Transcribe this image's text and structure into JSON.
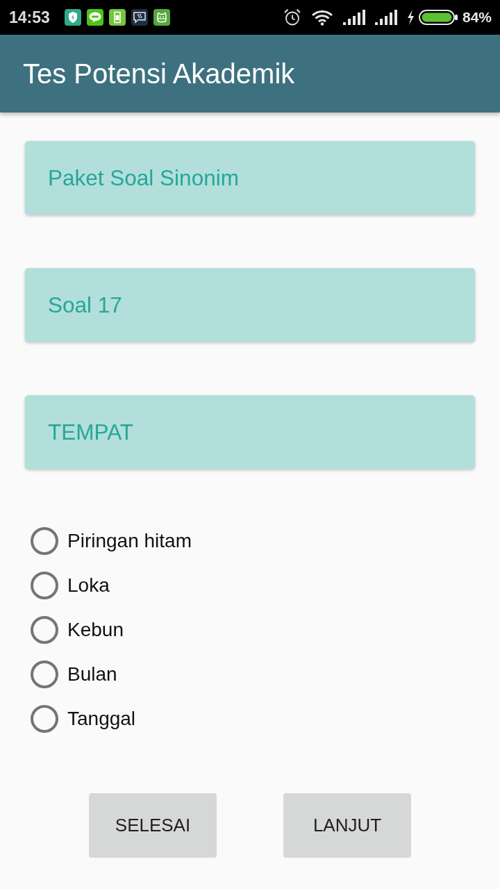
{
  "status_bar": {
    "time": "14:53",
    "battery_text": "84%"
  },
  "app_bar": {
    "title": "Tes Potensi Akademik"
  },
  "header_cards": [
    "Paket Soal Sinonim",
    "Soal 17",
    "TEMPAT"
  ],
  "options": [
    {
      "label": "Piringan hitam",
      "selected": false
    },
    {
      "label": "Loka",
      "selected": false
    },
    {
      "label": "Kebun",
      "selected": false
    },
    {
      "label": "Bulan",
      "selected": false
    },
    {
      "label": "Tanggal",
      "selected": false
    }
  ],
  "buttons": [
    {
      "label": "SELESAI"
    },
    {
      "label": "LANJUT"
    }
  ]
}
